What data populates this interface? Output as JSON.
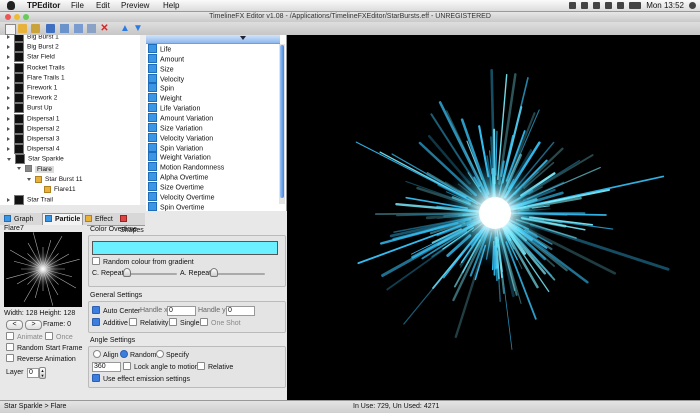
{
  "menubar": {
    "app_name": "TPEditor",
    "menus": [
      "File",
      "Edit",
      "Preview",
      "Help"
    ],
    "clock": "Mon 13:52"
  },
  "window": {
    "title": "TimelineFX Editor v1.08 - /Applications/TimelineFXEditor/StarBursts.eff - UNREGISTERED"
  },
  "tree": {
    "items": [
      {
        "label": "Big Burst 1",
        "depth": 0,
        "expanded": false
      },
      {
        "label": "Big Burst 2",
        "depth": 0,
        "expanded": false
      },
      {
        "label": "Star Field",
        "depth": 0,
        "expanded": false
      },
      {
        "label": "Rocket Trails",
        "depth": 0,
        "expanded": false
      },
      {
        "label": "Flare Trails 1",
        "depth": 0,
        "expanded": false
      },
      {
        "label": "Firework 1",
        "depth": 0,
        "expanded": false
      },
      {
        "label": "Firework 2",
        "depth": 0,
        "expanded": false
      },
      {
        "label": "Burst Up",
        "depth": 0,
        "expanded": false
      },
      {
        "label": "Dispersal 1",
        "depth": 0,
        "expanded": false
      },
      {
        "label": "Dispersal 2",
        "depth": 0,
        "expanded": false
      },
      {
        "label": "Dispersal 3",
        "depth": 0,
        "expanded": false
      },
      {
        "label": "Dispersal 4",
        "depth": 0,
        "expanded": false
      },
      {
        "label": "Star Sparkle",
        "depth": 0,
        "expanded": true
      },
      {
        "label": "Flare",
        "depth": 1,
        "expanded": true
      },
      {
        "label": "Star Burst 11",
        "depth": 2,
        "expanded": true
      },
      {
        "label": "Flare11",
        "depth": 3,
        "expanded": false
      },
      {
        "label": "Star Trail",
        "depth": 0,
        "expanded": false
      }
    ]
  },
  "attributes": [
    "Life",
    "Amount",
    "Size",
    "Velocity",
    "Spin",
    "Weight",
    "Life Variation",
    "Amount Variation",
    "Size Variation",
    "Velocity Variation",
    "Spin Variation",
    "Weight Variation",
    "Motion Randomness",
    "Alpha Overtime",
    "Size Overtime",
    "Velocity Overtime",
    "Spin Overtime"
  ],
  "tabs": {
    "graph": "Graph",
    "particle": "Particle",
    "effect": "Effect",
    "shapes": "Shapes"
  },
  "particle": {
    "sprite_name": "Flare7",
    "size_text": "Width: 128 Height: 128",
    "prev_label": "<",
    "next_label": ">",
    "frame_label": "Frame: 0",
    "animate_label": "Animate",
    "once_label": "Once",
    "random_start_label": "Random Start Frame",
    "reverse_label": "Reverse Animation",
    "layer_label": "Layer",
    "layer_value": "0"
  },
  "color_overtime": {
    "title": "Color Overtime",
    "bar_color": "#6af0ff",
    "random_label": "Random colour from gradient",
    "c_repeat_label": "C. Repeat",
    "a_repeat_label": "A. Repeat"
  },
  "general": {
    "title": "General Settings",
    "auto_center_label": "Auto Center",
    "handle_x_label": "Handle x",
    "handle_x_value": "0",
    "handle_y_label": "Handle y",
    "handle_y_value": "0",
    "additive_label": "Additive",
    "relativity_label": "Relativity",
    "single_label": "Single",
    "one_shot_label": "One Shot"
  },
  "angle": {
    "title": "Angle Settings",
    "align_label": "Align",
    "random_label": "Random",
    "specify_label": "Specify",
    "angle_value": "360",
    "lock_label": "Lock angle to motion",
    "relative_label": "Relative",
    "use_emission_label": "Use effect emission settings"
  },
  "status": {
    "path": "Star Sparkle > Flare",
    "usage": "In Use: 729, Un Used: 4271"
  }
}
